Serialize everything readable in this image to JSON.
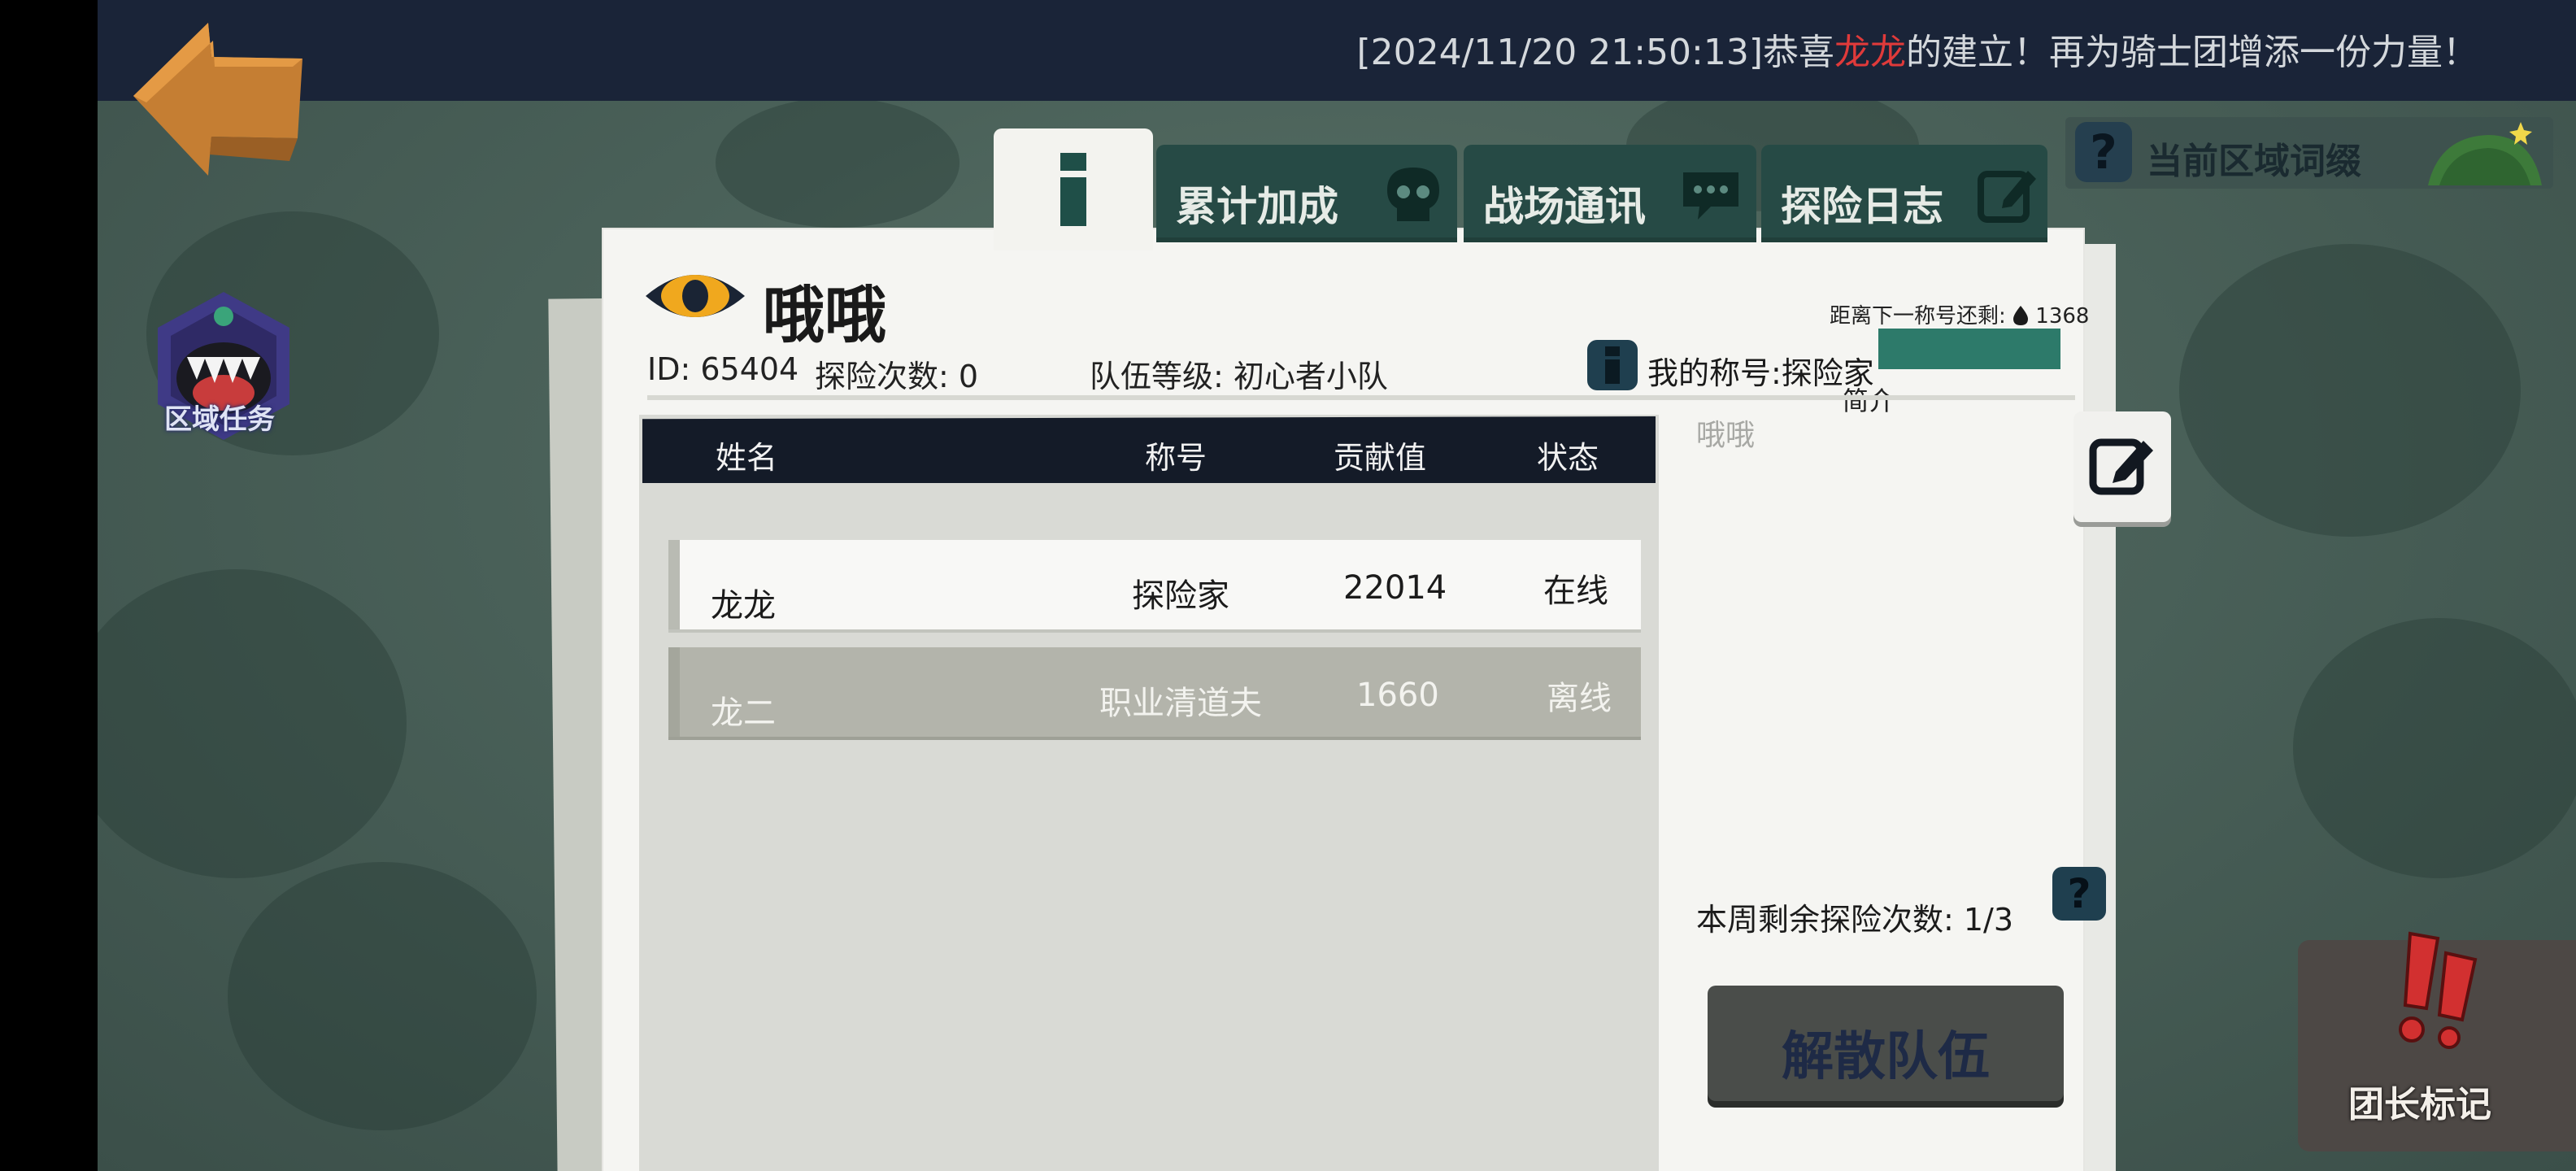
{
  "broadcast": {
    "prefix": "[2024/11/20 21:50:13]恭喜",
    "highlight": "龙龙",
    "suffix": "的建立！再为骑士团增添一份力量！"
  },
  "region_task": {
    "label": "区域任务"
  },
  "area_affix": {
    "q_mark": "?",
    "label": "当前区域词缀"
  },
  "tabs": [
    {
      "label": "累计加成",
      "icon": "skull-icon"
    },
    {
      "label": "战场通讯",
      "icon": "chat-icon"
    },
    {
      "label": "探险日志",
      "icon": "edit-icon"
    }
  ],
  "team": {
    "name": "哦哦",
    "id_text": "ID: 65404",
    "expeditions_text": "探险次数: 0",
    "level_text": "队伍等级: 初心者小队",
    "next_title_text": "距离下一称号还剩:",
    "next_title_value": "1368",
    "my_title_text": "我的称号:探险家",
    "intro_label": "简介",
    "intro_text": "哦哦"
  },
  "table": {
    "headers": [
      "姓名",
      "称号",
      "贡献值",
      "状态"
    ],
    "rows": [
      {
        "name": "龙龙",
        "title": "探险家",
        "contribution": "22014",
        "status": "在线"
      },
      {
        "name": "龙二",
        "title": "职业清道夫",
        "contribution": "1660",
        "status": "离线"
      }
    ]
  },
  "weekly": {
    "label": "本周剩余探险次数:  1/3",
    "q_mark": "?"
  },
  "buttons": {
    "disband": "解散队伍"
  },
  "leader_mark": {
    "label": "团长标记"
  },
  "colors": {
    "top_bar": "#1a2438",
    "highlight_red": "#e03a3a",
    "tab_teal": "#264a45",
    "table_header": "#141b28",
    "disband_button": "#4a4d4a"
  }
}
